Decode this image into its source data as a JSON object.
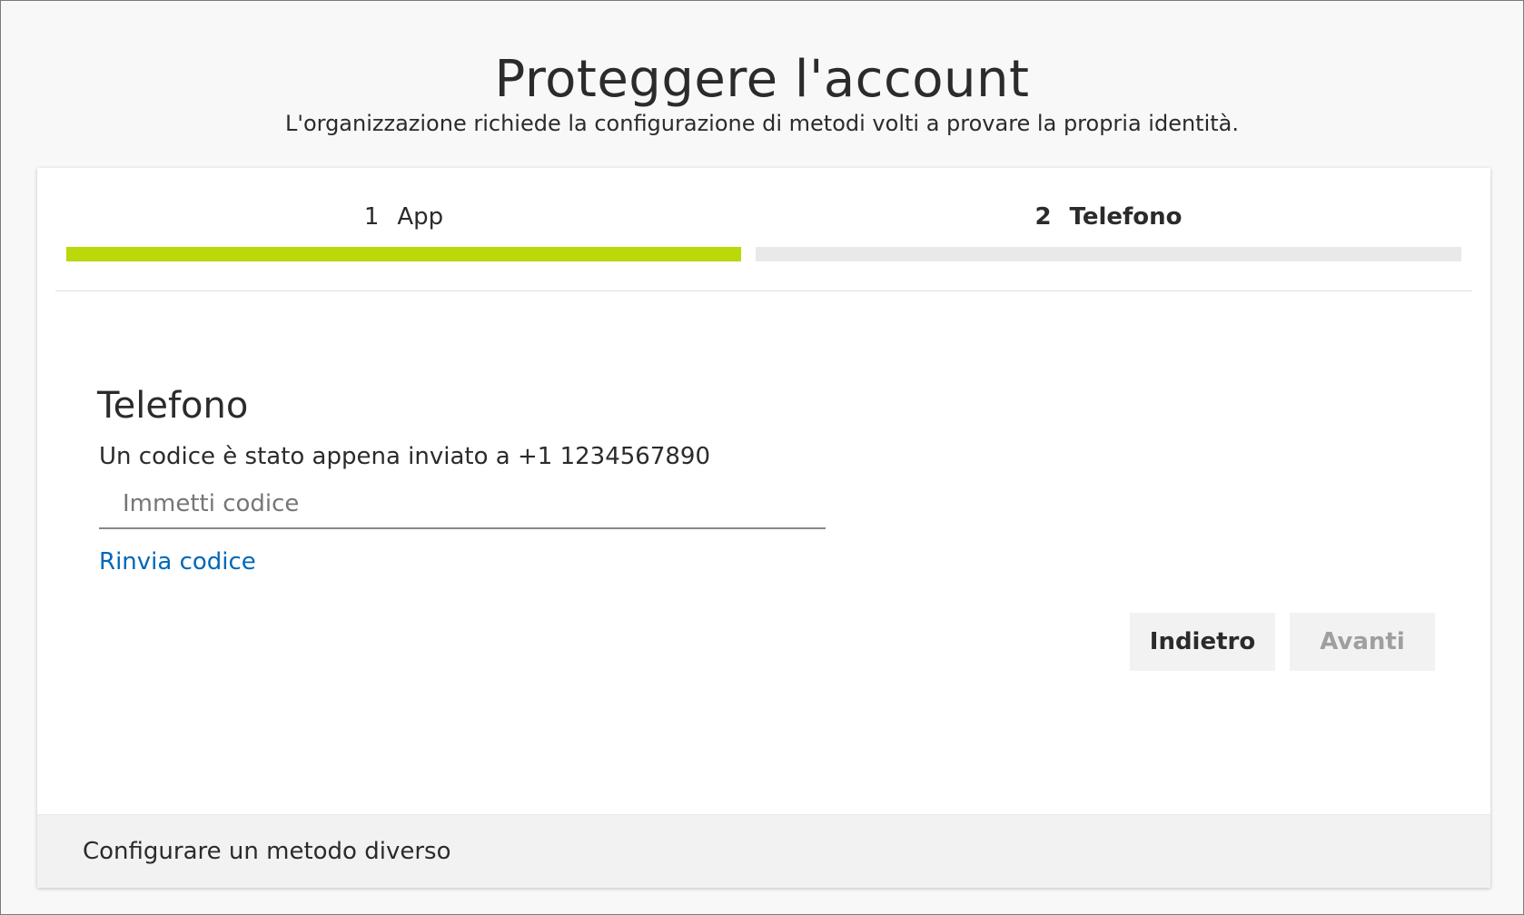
{
  "header": {
    "title": "Proteggere l'account",
    "subtitle": "L'organizzazione richiede la configurazione di metodi volti a provare la propria identità."
  },
  "steps": [
    {
      "number": "1",
      "label": "App",
      "state": "completed",
      "progress": 1.0,
      "color": "#bad80a"
    },
    {
      "number": "2",
      "label": "Telefono",
      "state": "current",
      "progress": 0.0,
      "color": "#e9e9e9"
    }
  ],
  "section": {
    "title": "Telefono",
    "info": "Un codice è stato appena inviato a +1 1234567890",
    "code_input": {
      "value": "",
      "placeholder": "Immetti codice"
    },
    "resend_link": "Rinvia codice"
  },
  "buttons": {
    "back": "Indietro",
    "next": "Avanti",
    "next_disabled": true
  },
  "footer": {
    "link": "Configurare un metodo diverso"
  },
  "colors": {
    "accent_green": "#bad80a",
    "link_blue": "#0067b8",
    "button_bg": "#f2f2f2",
    "disabled_text": "#a19f9d"
  }
}
